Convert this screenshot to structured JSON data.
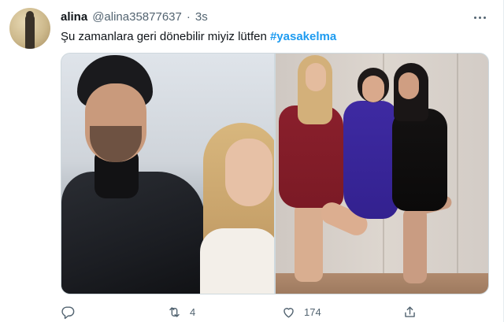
{
  "tweet": {
    "author_name": "alina",
    "author_handle": "@alina35877637",
    "separator": "·",
    "timestamp": "3s",
    "text": "Şu zamanlara geri dönebilir miyiz lütfen ",
    "hashtag": "#yasakelma"
  },
  "actions": {
    "reply_count": "",
    "retweet_count": "4",
    "like_count": "174"
  },
  "icons": {
    "more": "more-horizontal-icon",
    "reply": "reply-icon",
    "retweet": "retweet-icon",
    "like": "heart-icon",
    "share": "share-icon"
  },
  "colors": {
    "hashtag": "#1d9bf0",
    "secondary_text": "#536471",
    "primary_text": "#0f1419",
    "border": "#cfd9de"
  }
}
